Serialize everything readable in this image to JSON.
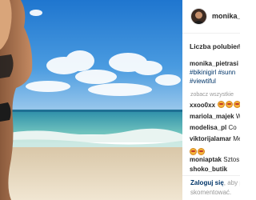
{
  "post": {
    "username": "monika_p",
    "likes_label": "Liczba polubień:",
    "caption_user": "monika_pietrasi",
    "hashtags": [
      "#bikinigirl #sunn",
      "#viewtiful"
    ],
    "see_all": "zobacz wszystkie"
  },
  "comments": [
    {
      "user": "xxoo0xx",
      "text": ""
    },
    {
      "user": "mariola_majek",
      "text": "W"
    },
    {
      "user": "modelisa_pl",
      "text": "Co"
    },
    {
      "user": "viktorijalamar",
      "text": "Me"
    },
    {
      "user": "moniaptak",
      "text": "Sztos"
    },
    {
      "user": "shoko_butik",
      "text": ""
    }
  ],
  "footer": {
    "login_link": "Zaloguj się",
    "login_text": ", aby p",
    "login_line2": "skomentować."
  },
  "colors": {
    "link": "#003569",
    "muted": "#999999",
    "sky": "#2f8ad8",
    "sea": "#3aa6a8",
    "sand": "#e9d7b9"
  },
  "icons": [
    "emoji-icon",
    "avatar"
  ]
}
